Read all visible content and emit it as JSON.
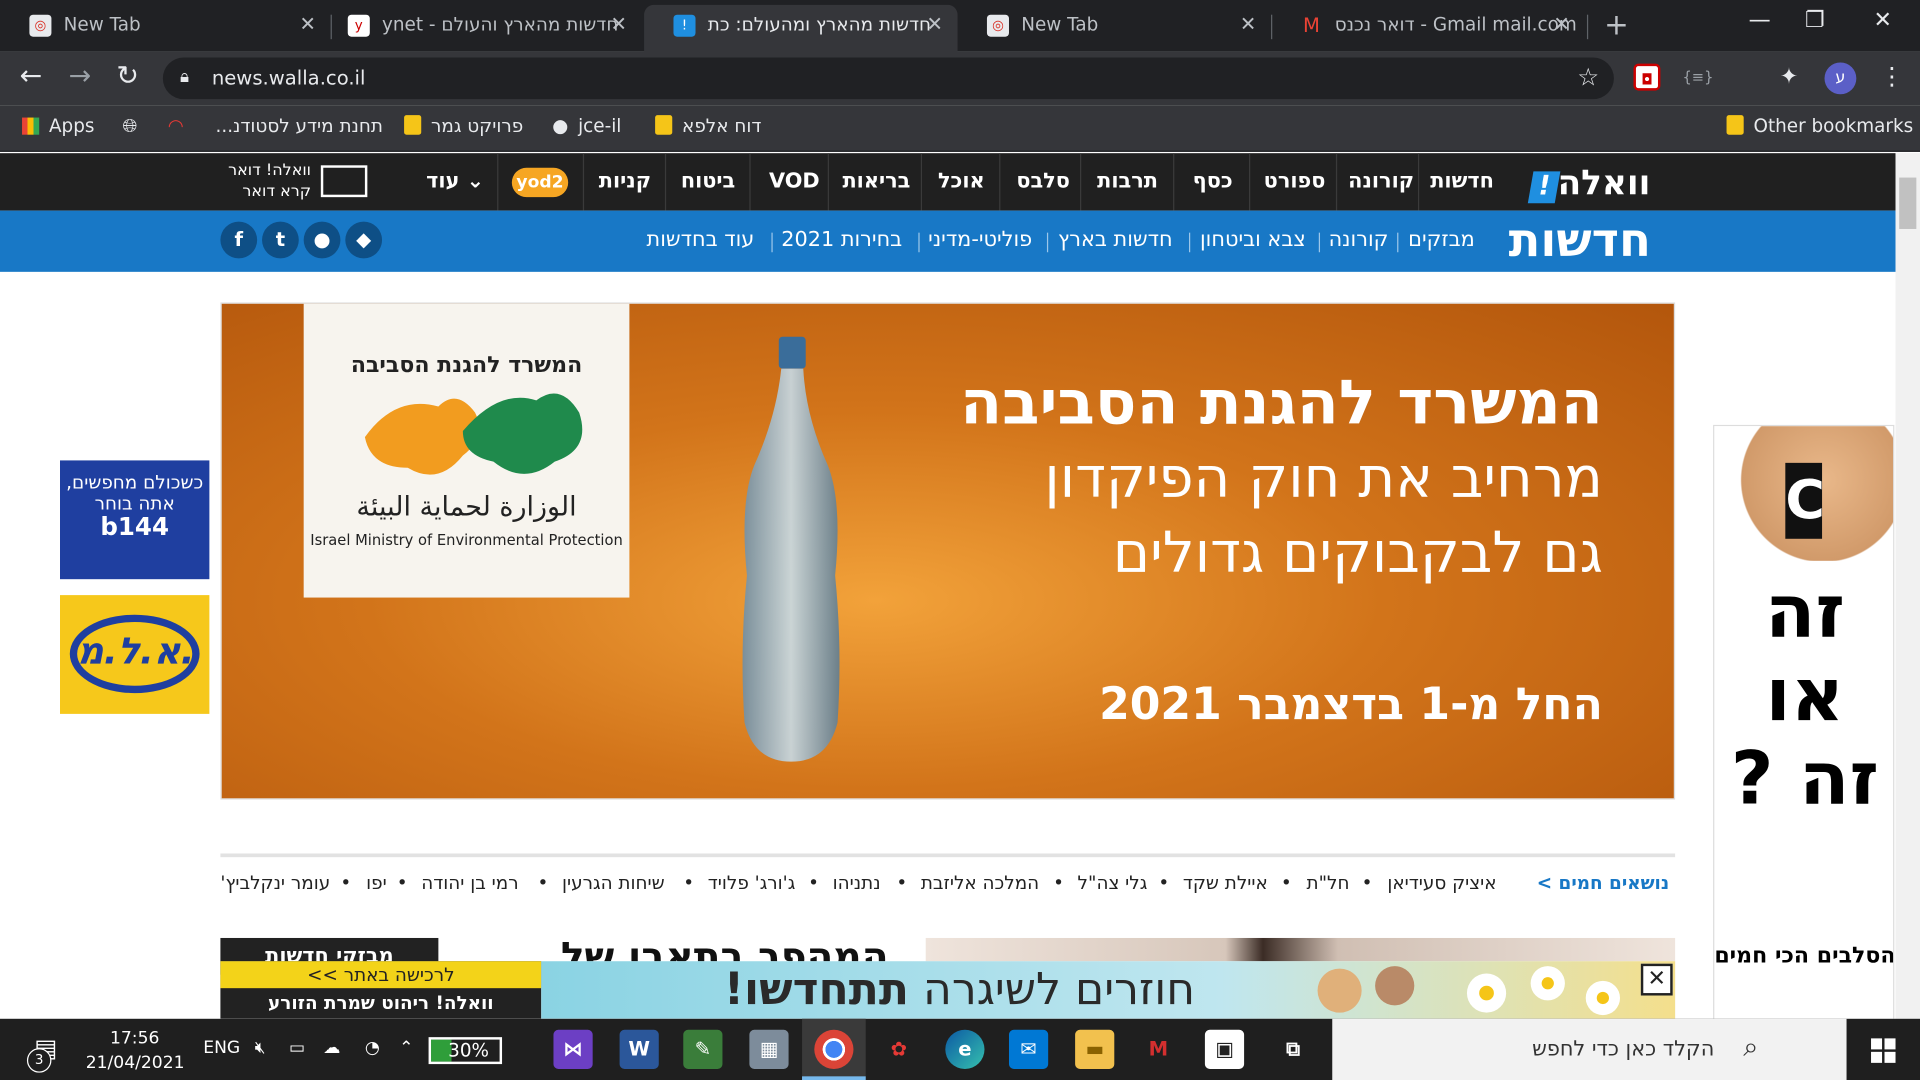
{
  "browser": {
    "tabs": [
      {
        "title": "New Tab",
        "active": false
      },
      {
        "title": "ynet - חדשות מהארץ והעולם",
        "active": false
      },
      {
        "title": "חדשות מהארץ ומהעולם: כת",
        "active": true
      },
      {
        "title": "New Tab",
        "active": false
      },
      {
        "title": "דואר נכנס - Gmail ‏mail.com",
        "active": false
      }
    ],
    "new_tab_symbol": "+",
    "url": "news.walla.co.il",
    "profile_initial": "ע",
    "bookmarks": [
      {
        "label": "Apps",
        "icon": "apps-grid-icon"
      },
      {
        "label": "",
        "icon": "globe-icon"
      },
      {
        "label": "",
        "icon": "lips-icon"
      },
      {
        "label": "תחנת מידע לסטודנ...",
        "icon": "folder-icon"
      },
      {
        "label": "פרויקט גמר",
        "icon": "folder-icon"
      },
      {
        "label": "jce-il",
        "icon": "github-icon"
      },
      {
        "label": "דוח אלפא",
        "icon": "folder-icon"
      }
    ],
    "other_bookmarks": "Other bookmarks"
  },
  "walla": {
    "logo": "וואלה",
    "nav": [
      "חדשות",
      "קורונה",
      "ספורט",
      "כסף",
      "תרבות",
      "סלבס",
      "אוכל",
      "בריאות",
      "VOD",
      "ביטוח",
      "קניות",
      "עוד"
    ],
    "yod2": "yod2",
    "mail_label": "וואלה! דואר קרא דואר",
    "section_title": "חדשות",
    "subnav": [
      "מבזקים",
      "קורונה",
      "צבא וביטחון",
      "חדשות בארץ",
      "פוליטי-מדיני",
      "בחירות 2021",
      "עוד בחדשות"
    ],
    "social": [
      "f",
      "t",
      "",
      ""
    ],
    "social_icons": [
      "facebook-icon",
      "twitter-icon",
      "apple-icon",
      "android-icon"
    ]
  },
  "main_ad": {
    "ministry_he": "המשרד להגנת הסביבה",
    "ministry_ar": "الوزارة لحماية البيئة",
    "ministry_en": "Israel Ministry of Environmental Protection",
    "line1": "המשרד להגנת הסביבה",
    "line2": "מרחיב את חוק הפיקדון",
    "line3": "גם לבקבוקים גדולים",
    "date_line": "החל מ-1 בדצמבר 2021"
  },
  "left_ads": {
    "ad1_text": "כשכולם מחפשים, אתה בוחר",
    "ad1_brand": "b144",
    "ad2_brand": "א.ל.מ."
  },
  "right_ad": {
    "big_text": "זה או זה ?",
    "small_text": "הסלבים הכי חמים"
  },
  "hot_topics": {
    "title": "נושאים חמים >",
    "items": [
      "איציק סעידיאן",
      "חל\"ת",
      "איילת שקד",
      "גלי צה\"ל",
      "המלכה אליזבת",
      "נתניהו",
      "ג'ורג' פלויד",
      "שיחות הגרעין",
      "רמי בן יהודה",
      "יפו",
      "עומר ינקלביץ'"
    ]
  },
  "content": {
    "flash_label": "מבזקי חדשות",
    "headline": "המהפך בתאבו של"
  },
  "bottom_ad": {
    "top_text": "לרכישה באתר >>",
    "bottom_text": "וואלה! ריהוט שמרת הזורע",
    "headline_light": "חוזרים לשיגרה",
    "headline_bold": "תתחדשו!",
    "close": "✕"
  },
  "taskbar": {
    "search_placeholder": "הקלד כאן כדי לחפש",
    "time": "17:56",
    "date": "21/04/2021",
    "language": "ENG",
    "battery": "30%",
    "notifications": "3"
  }
}
